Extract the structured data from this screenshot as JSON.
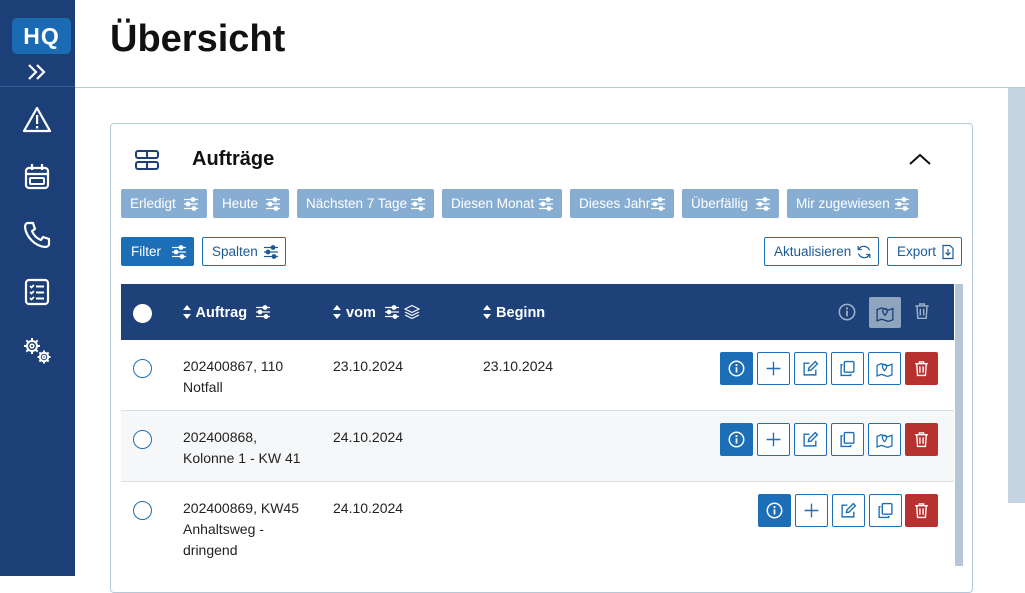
{
  "sidebar": {
    "logo": "HQ",
    "items": [
      {
        "icon": "warning-icon"
      },
      {
        "icon": "calendar-icon"
      },
      {
        "icon": "phone-icon"
      },
      {
        "icon": "checklist-icon"
      },
      {
        "icon": "settings-gears-icon"
      }
    ]
  },
  "header": {
    "title": "Übersicht"
  },
  "card": {
    "title": "Aufträge",
    "quick_filters": [
      "Erledigt",
      "Heute",
      "Nächsten 7 Tage",
      "Diesen Monat",
      "Dieses Jahr",
      "Überfällig",
      "Mir zugewiesen"
    ],
    "filter_label": "Filter",
    "columns_label": "Spalten",
    "refresh_label": "Aktualisieren",
    "export_label": "Export"
  },
  "table": {
    "headers": {
      "auftrag": "Auftrag",
      "vom": "vom",
      "beginn": "Beginn"
    },
    "rows": [
      {
        "auftrag_line1": "202400867, 110",
        "auftrag_line2": "Notfall",
        "auftrag_line3": "",
        "vom": "23.10.2024",
        "beginn": "23.10.2024"
      },
      {
        "auftrag_line1": "202400868,",
        "auftrag_line2": "Kolonne 1 - KW 41",
        "auftrag_line3": "",
        "vom": "24.10.2024",
        "beginn": ""
      },
      {
        "auftrag_line1": "202400869, KW45",
        "auftrag_line2": "Anhaltsweg -",
        "auftrag_line3": "dringend",
        "vom": "24.10.2024",
        "beginn": ""
      }
    ]
  },
  "colors": {
    "sidebar": "#1d3f77",
    "accent": "#1c6fb6",
    "chip": "#87aed2",
    "danger": "#b7312f",
    "table_header": "#1e417a"
  }
}
